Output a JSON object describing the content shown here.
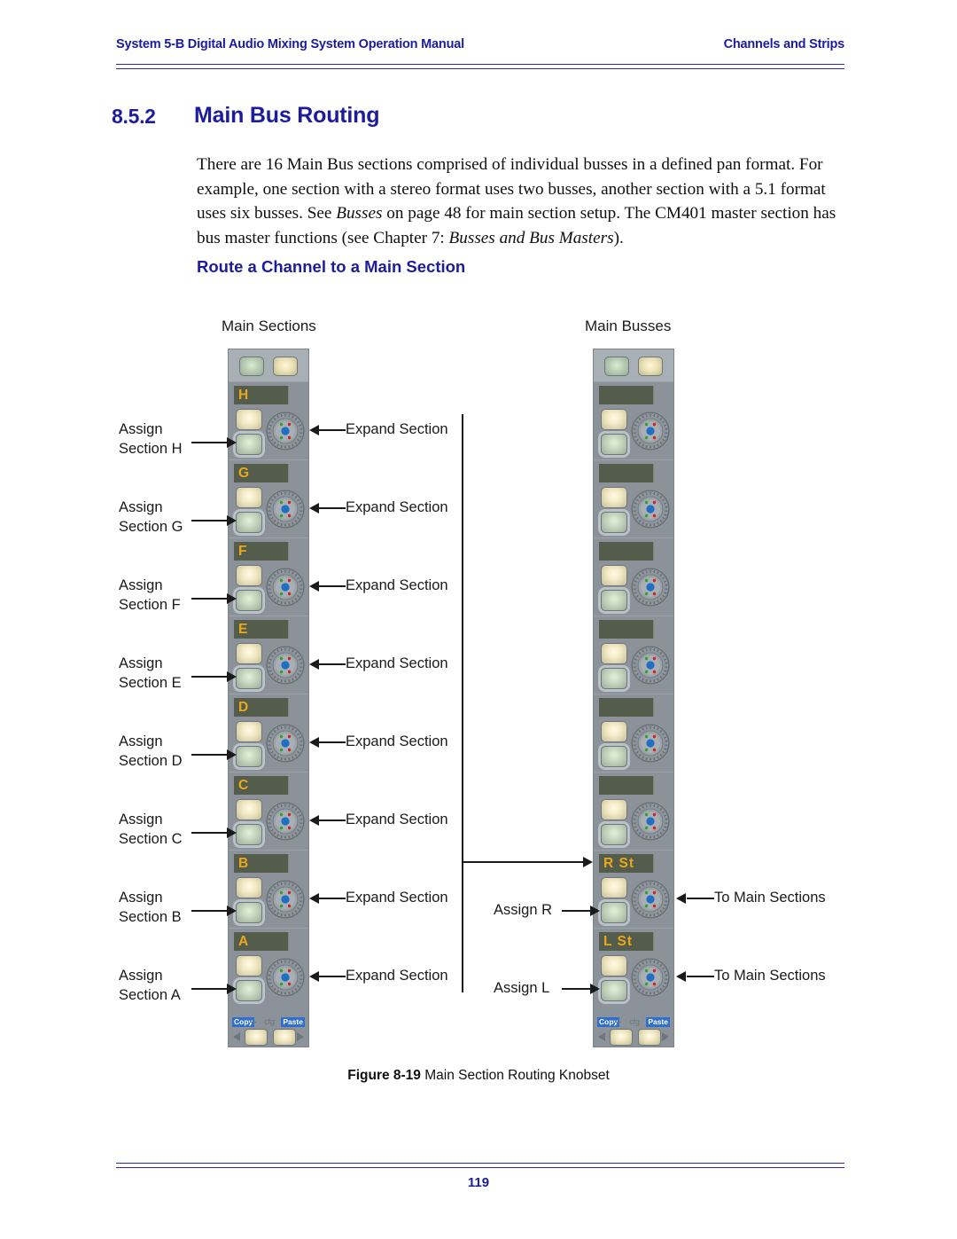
{
  "header": {
    "left": "System 5-B Digital Audio Mixing System Operation Manual",
    "right": "Channels and Strips"
  },
  "heading": {
    "number": "8.5.2",
    "title": "Main Bus Routing"
  },
  "body": {
    "paragraph_p1": "There are 16 Main Bus sections comprised of individual busses in a defined pan format. For example, one section with a stereo format uses two busses, another section with a 5.1 format uses six busses. See ",
    "paragraph_em1": "Busses",
    "paragraph_p2": " on page 48 for main section setup. The CM401 master section has bus master functions (see Chapter 7: ",
    "paragraph_em2": "Busses and Bus Masters",
    "paragraph_p3": ")."
  },
  "subheading": "Route a Channel to a Main Section",
  "figure": {
    "column_labels": {
      "left": "Main Sections",
      "right": "Main Busses"
    },
    "left_panel": {
      "sections": [
        {
          "label": "H",
          "assign_label_line1": "Assign",
          "assign_label_line2": "Section H",
          "expand_label": "Expand Section"
        },
        {
          "label": "G",
          "assign_label_line1": "Assign",
          "assign_label_line2": "Section G",
          "expand_label": "Expand Section"
        },
        {
          "label": "F",
          "assign_label_line1": "Assign",
          "assign_label_line2": "Section F",
          "expand_label": "Expand Section"
        },
        {
          "label": "E",
          "assign_label_line1": "Assign",
          "assign_label_line2": "Section E",
          "expand_label": "Expand Section"
        },
        {
          "label": "D",
          "assign_label_line1": "Assign",
          "assign_label_line2": "Section D",
          "expand_label": "Expand Section"
        },
        {
          "label": "C",
          "assign_label_line1": "Assign",
          "assign_label_line2": "Section C",
          "expand_label": "Expand Section"
        },
        {
          "label": "B",
          "assign_label_line1": "Assign",
          "assign_label_line2": "Section B",
          "expand_label": "Expand Section"
        },
        {
          "label": "A",
          "assign_label_line1": "Assign",
          "assign_label_line2": "Section A",
          "expand_label": "Expand Section"
        }
      ]
    },
    "right_panel": {
      "sections": [
        {
          "label": ""
        },
        {
          "label": ""
        },
        {
          "label": ""
        },
        {
          "label": ""
        },
        {
          "label": ""
        },
        {
          "label": ""
        },
        {
          "label": "R  St",
          "assign_label": "Assign R",
          "to_label": "To Main Sections"
        },
        {
          "label": "L  St",
          "assign_label": "Assign L",
          "to_label": "To Main Sections"
        }
      ]
    },
    "panel_footer": {
      "copy": "Copy",
      "cfg": "cfg",
      "paste": "Paste"
    },
    "caption_bold": "Figure 8-19",
    "caption_text": " Main Section Routing Knobset"
  },
  "footer": {
    "page_number": "119"
  },
  "colors": {
    "accent_blue": "#1c1c9c",
    "panel_body": "#8b9299",
    "panel_top": "#a8b0b6",
    "label_bar": "#545c4c",
    "label_text": "#e9a81b",
    "badge_blue": "#2f6fd0",
    "knob_center": "#1f6fc4"
  }
}
